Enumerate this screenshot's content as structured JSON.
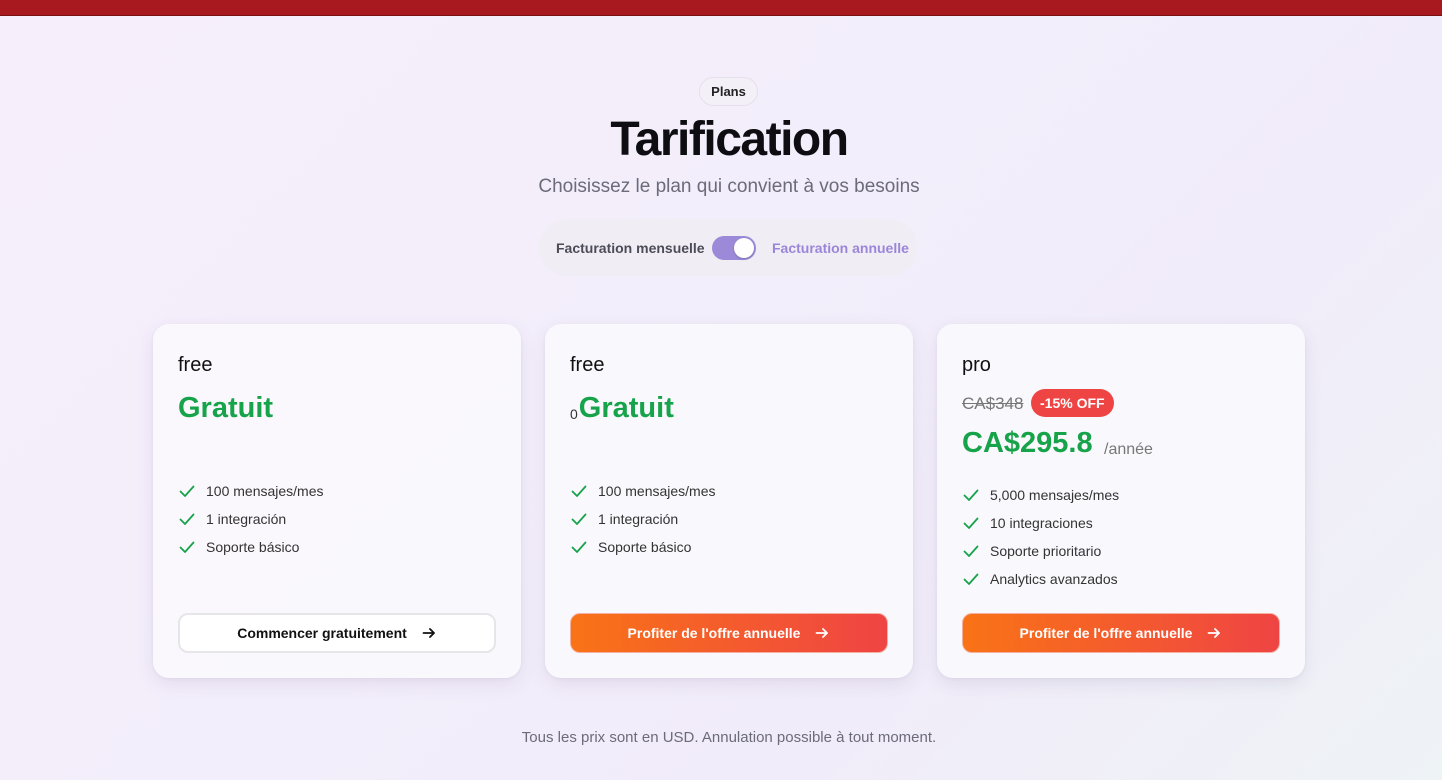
{
  "header": {
    "badge": "Plans",
    "title": "Tarification",
    "subtitle": "Choisissez le plan qui convient à vos besoins"
  },
  "billing": {
    "monthly_label": "Facturation mensuelle",
    "annual_label": "Facturation annuelle",
    "annual_selected": true
  },
  "cards": [
    {
      "plan": "free",
      "price": "Gratuit",
      "features": [
        "100 mensajes/mes",
        "1 integración",
        "Soporte básico"
      ],
      "button": "Commencer gratuitement"
    },
    {
      "plan": "free",
      "price_prefix": "0",
      "price": "Gratuit",
      "features": [
        "100 mensajes/mes",
        "1 integración",
        "Soporte básico"
      ],
      "button": "Profiter de l'offre annuelle"
    },
    {
      "plan": "pro",
      "old_price": "CA$348",
      "discount": "-15% OFF",
      "price": "CA$295.8",
      "period": "/année",
      "features": [
        "5,000 mensajes/mes",
        "10 integraciones",
        "Soporte prioritario",
        "Analytics avanzados"
      ],
      "button": "Profiter de l'offre annuelle"
    }
  ],
  "footer": "Tous les prix sont en USD. Annulation possible à tout moment.",
  "colors": {
    "accent_green": "#16a34a",
    "toggle_purple": "#9c8ad8",
    "discount_red": "#ef4444",
    "button_gradient_start": "#f97316",
    "button_gradient_end": "#ef4444",
    "browser_bar": "#a8191f"
  },
  "icons": {
    "feature": "check-icon",
    "button": "arrow-right-icon"
  }
}
